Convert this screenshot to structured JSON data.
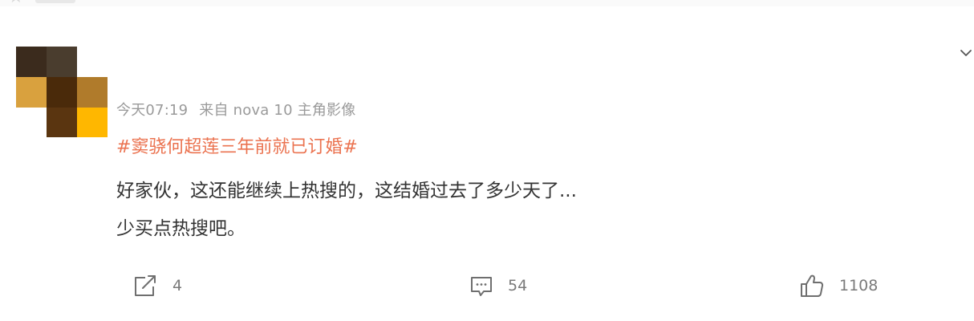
{
  "avatar": {
    "pixels": [
      "#3b2b1d",
      "#4a3d2e",
      "#ffffff",
      "#d9a13e",
      "#4a2a0a",
      "#b07b2b",
      "#ffffff",
      "#5a3510",
      "#ffb700"
    ]
  },
  "post": {
    "meta": {
      "time": "今天07:19",
      "source": "来自 nova 10 主角影像"
    },
    "topic": "#窦骁何超莲三年前就已订婚#",
    "text_line1": "好家伙，这还能继续上热搜的，这结婚过去了多少天了...",
    "text_line2": "少买点热搜吧。"
  },
  "actions": {
    "share_count": "4",
    "comment_count": "54",
    "like_count": "1108"
  },
  "colors": {
    "topic": "#eb7350",
    "text": "#333333",
    "meta": "#9a9a9a",
    "icon": "#6f6f6f"
  },
  "icons": {
    "menu": "chevron-down-icon",
    "share": "share-icon",
    "comment": "comment-icon",
    "like": "thumbs-up-icon"
  }
}
